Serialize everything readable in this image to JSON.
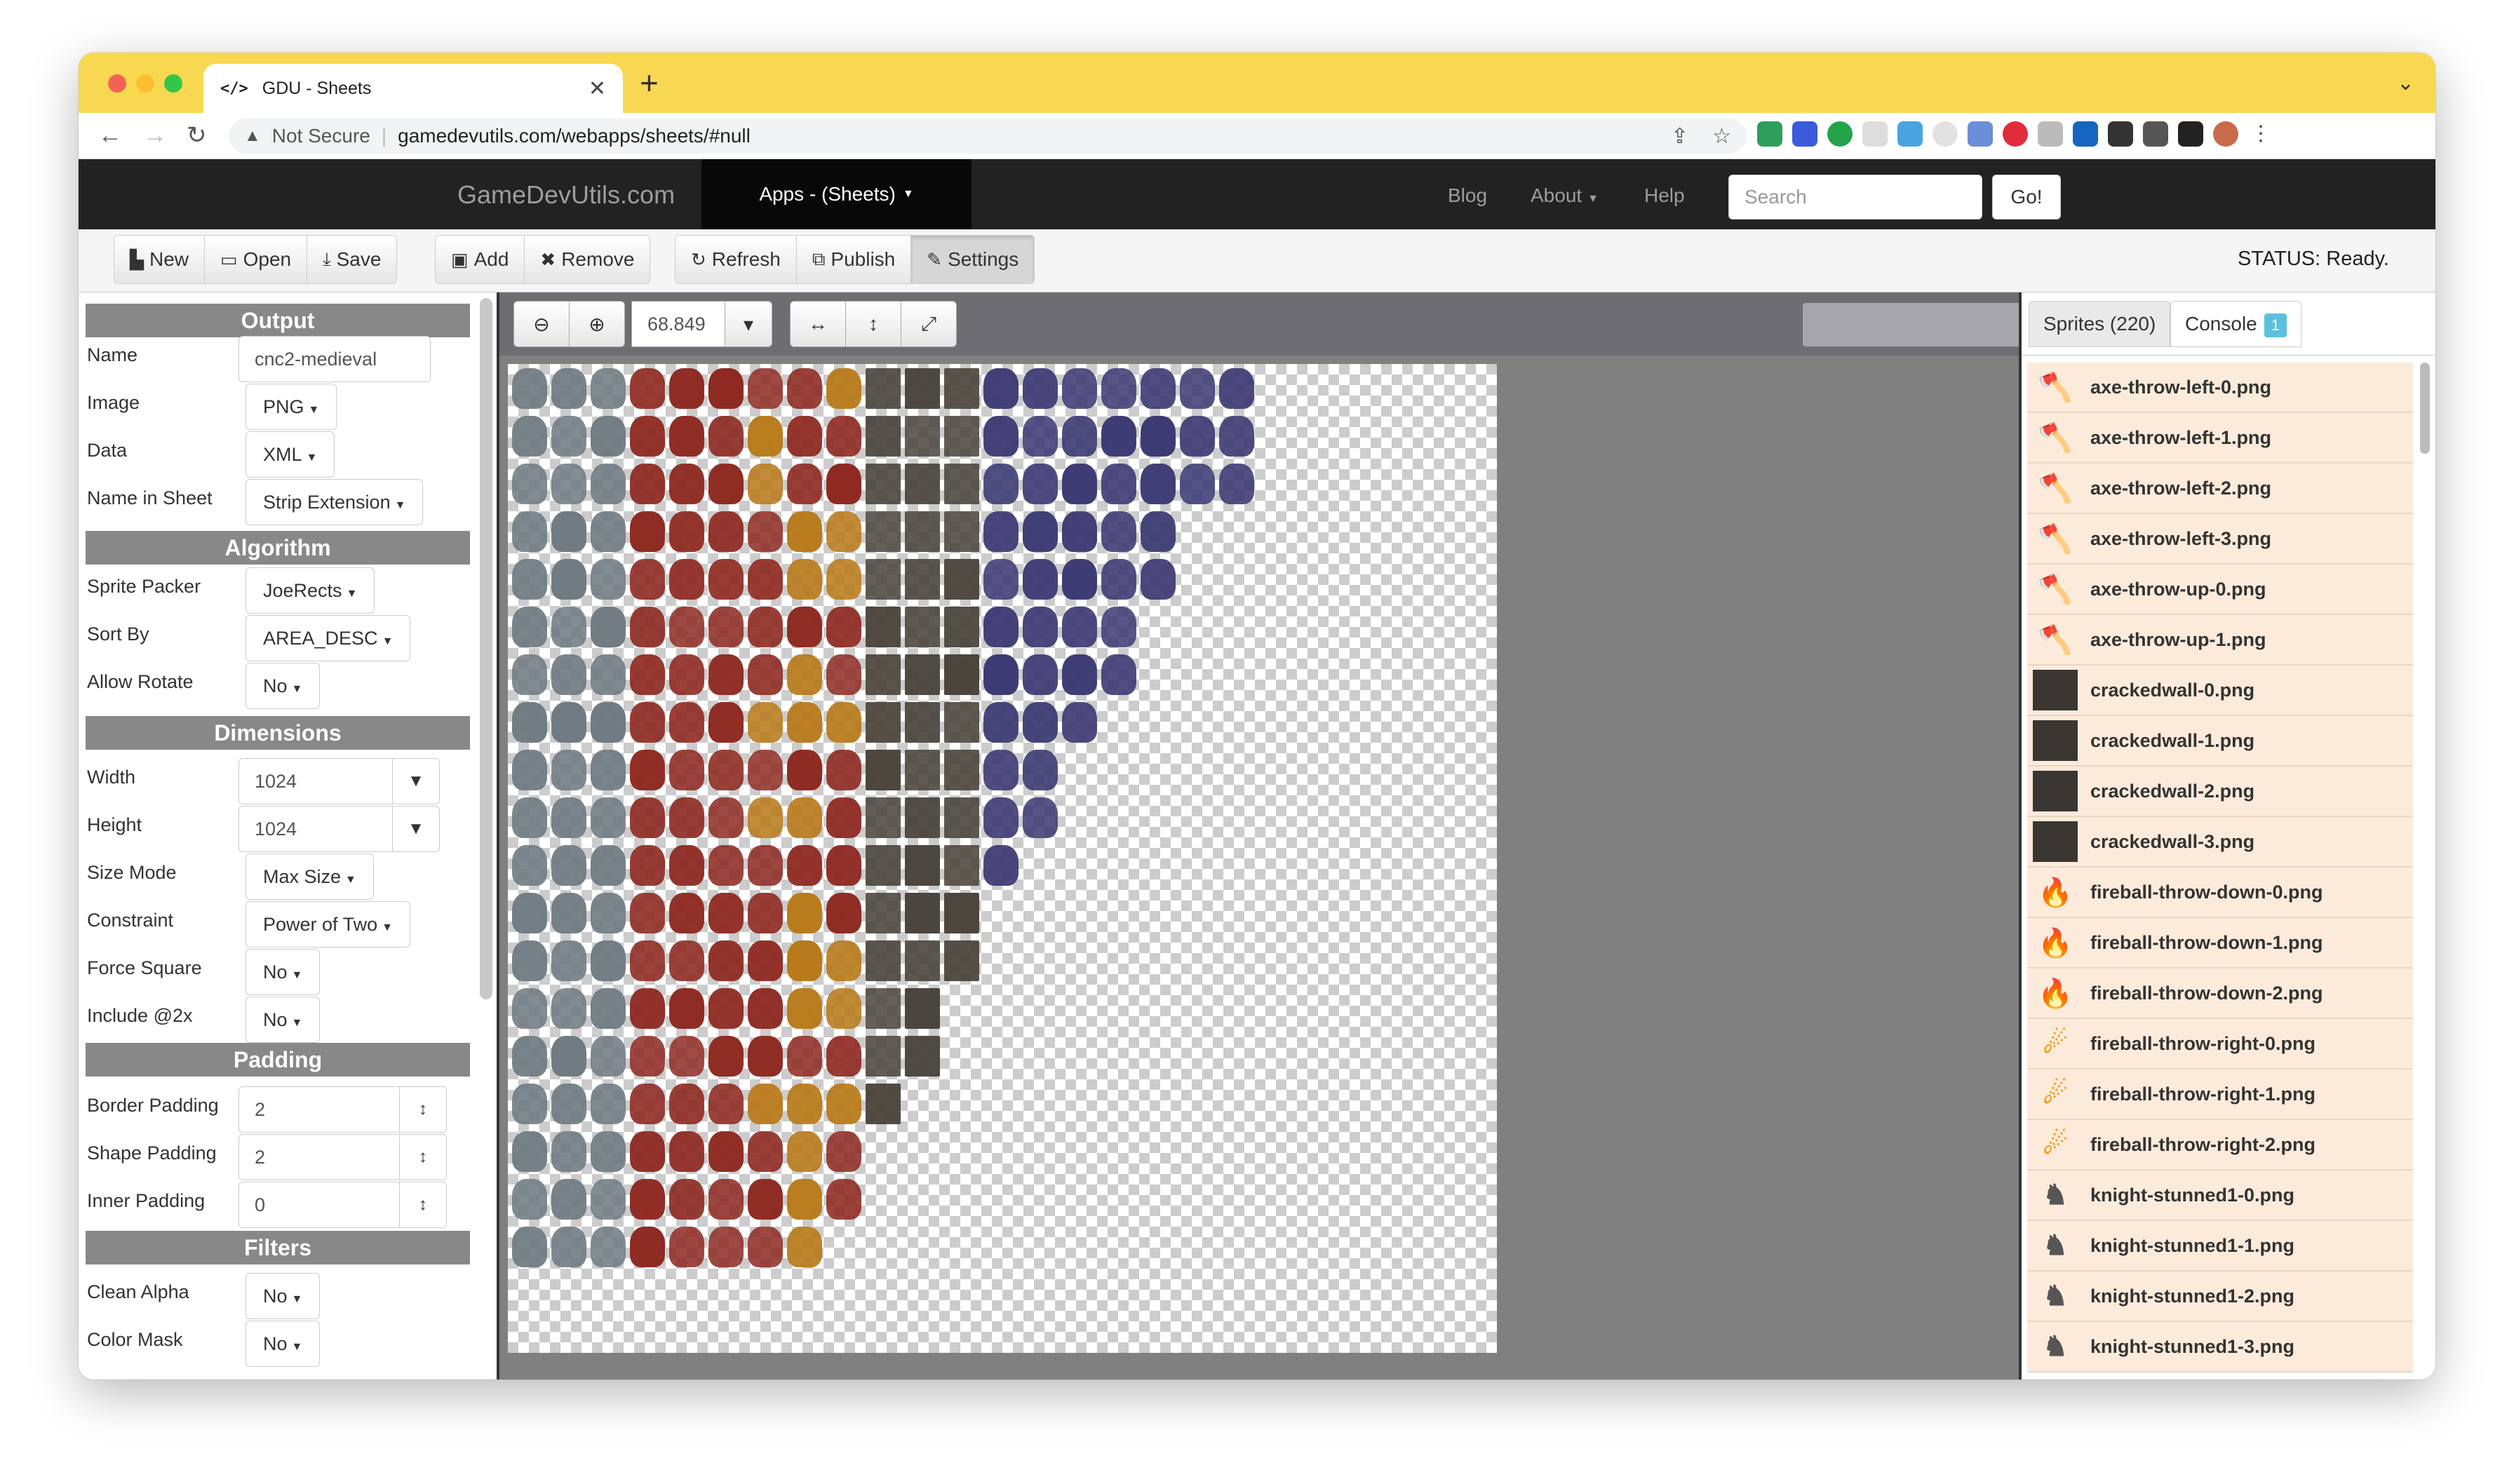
{
  "browser": {
    "tab_title": "GDU - Sheets",
    "tab_icon": "</>",
    "new_tab": "+",
    "security": "Not Secure",
    "url": "gamedevutils.com/webapps/sheets/#null"
  },
  "navbar": {
    "brand": "GameDevUtils.com",
    "apps_menu": "Apps - (Sheets)",
    "links": [
      "Blog",
      "About",
      "Help"
    ],
    "search_placeholder": "Search",
    "go": "Go!"
  },
  "toolbar": {
    "new": "New",
    "open": "Open",
    "save": "Save",
    "add": "Add",
    "remove": "Remove",
    "refresh": "Refresh",
    "publish": "Publish",
    "settings": "Settings",
    "status": "STATUS: Ready."
  },
  "settings": {
    "output": {
      "header": "Output",
      "name_label": "Name",
      "name_value": "cnc2-medieval",
      "image_label": "Image",
      "image_value": "PNG",
      "data_label": "Data",
      "data_value": "XML",
      "nameinsheet_label": "Name in Sheet",
      "nameinsheet_value": "Strip Extension"
    },
    "algorithm": {
      "header": "Algorithm",
      "packer_label": "Sprite Packer",
      "packer_value": "JoeRects",
      "sort_label": "Sort By",
      "sort_value": "AREA_DESC",
      "rotate_label": "Allow Rotate",
      "rotate_value": "No"
    },
    "dimensions": {
      "header": "Dimensions",
      "width_label": "Width",
      "width_value": "1024",
      "height_label": "Height",
      "height_value": "1024",
      "sizemode_label": "Size Mode",
      "sizemode_value": "Max Size",
      "constraint_label": "Constraint",
      "constraint_value": "Power of Two",
      "forcesquare_label": "Force Square",
      "forcesquare_value": "No",
      "include2x_label": "Include @2x",
      "include2x_value": "No"
    },
    "padding": {
      "header": "Padding",
      "border_label": "Border Padding",
      "border_value": "2",
      "shape_label": "Shape Padding",
      "shape_value": "2",
      "inner_label": "Inner Padding",
      "inner_value": "0"
    },
    "filters": {
      "header": "Filters",
      "cleanalpha_label": "Clean Alpha",
      "cleanalpha_value": "No",
      "colormask_label": "Color Mask",
      "colormask_value": "No"
    }
  },
  "canvas": {
    "zoom": "68.849"
  },
  "sprites_panel": {
    "sprites_tab": "Sprites (220)",
    "console_tab": "Console",
    "console_count": "1",
    "items": [
      {
        "name": "axe-throw-left-0.png",
        "icon": "axe-icon"
      },
      {
        "name": "axe-throw-left-1.png",
        "icon": "axe-icon"
      },
      {
        "name": "axe-throw-left-2.png",
        "icon": "axe-icon"
      },
      {
        "name": "axe-throw-left-3.png",
        "icon": "axe-icon"
      },
      {
        "name": "axe-throw-up-0.png",
        "icon": "axe-icon"
      },
      {
        "name": "axe-throw-up-1.png",
        "icon": "axe-icon"
      },
      {
        "name": "crackedwall-0.png",
        "icon": "wall-icon"
      },
      {
        "name": "crackedwall-1.png",
        "icon": "wall-icon"
      },
      {
        "name": "crackedwall-2.png",
        "icon": "wall-icon"
      },
      {
        "name": "crackedwall-3.png",
        "icon": "wall-icon"
      },
      {
        "name": "fireball-throw-down-0.png",
        "icon": "fire-icon"
      },
      {
        "name": "fireball-throw-down-1.png",
        "icon": "fire-icon"
      },
      {
        "name": "fireball-throw-down-2.png",
        "icon": "fire-icon"
      },
      {
        "name": "fireball-throw-right-0.png",
        "icon": "fireball-icon"
      },
      {
        "name": "fireball-throw-right-1.png",
        "icon": "fireball-icon"
      },
      {
        "name": "fireball-throw-right-2.png",
        "icon": "fireball-icon"
      },
      {
        "name": "knight-stunned1-0.png",
        "icon": "knight-icon"
      },
      {
        "name": "knight-stunned1-1.png",
        "icon": "knight-icon"
      },
      {
        "name": "knight-stunned1-2.png",
        "icon": "knight-icon"
      },
      {
        "name": "knight-stunned1-3.png",
        "icon": "knight-icon"
      }
    ]
  },
  "colors": {
    "tabstrip": "#f8d850",
    "navbar": "#222222",
    "row_bg": "#fcebdb",
    "section_header": "#888888"
  }
}
